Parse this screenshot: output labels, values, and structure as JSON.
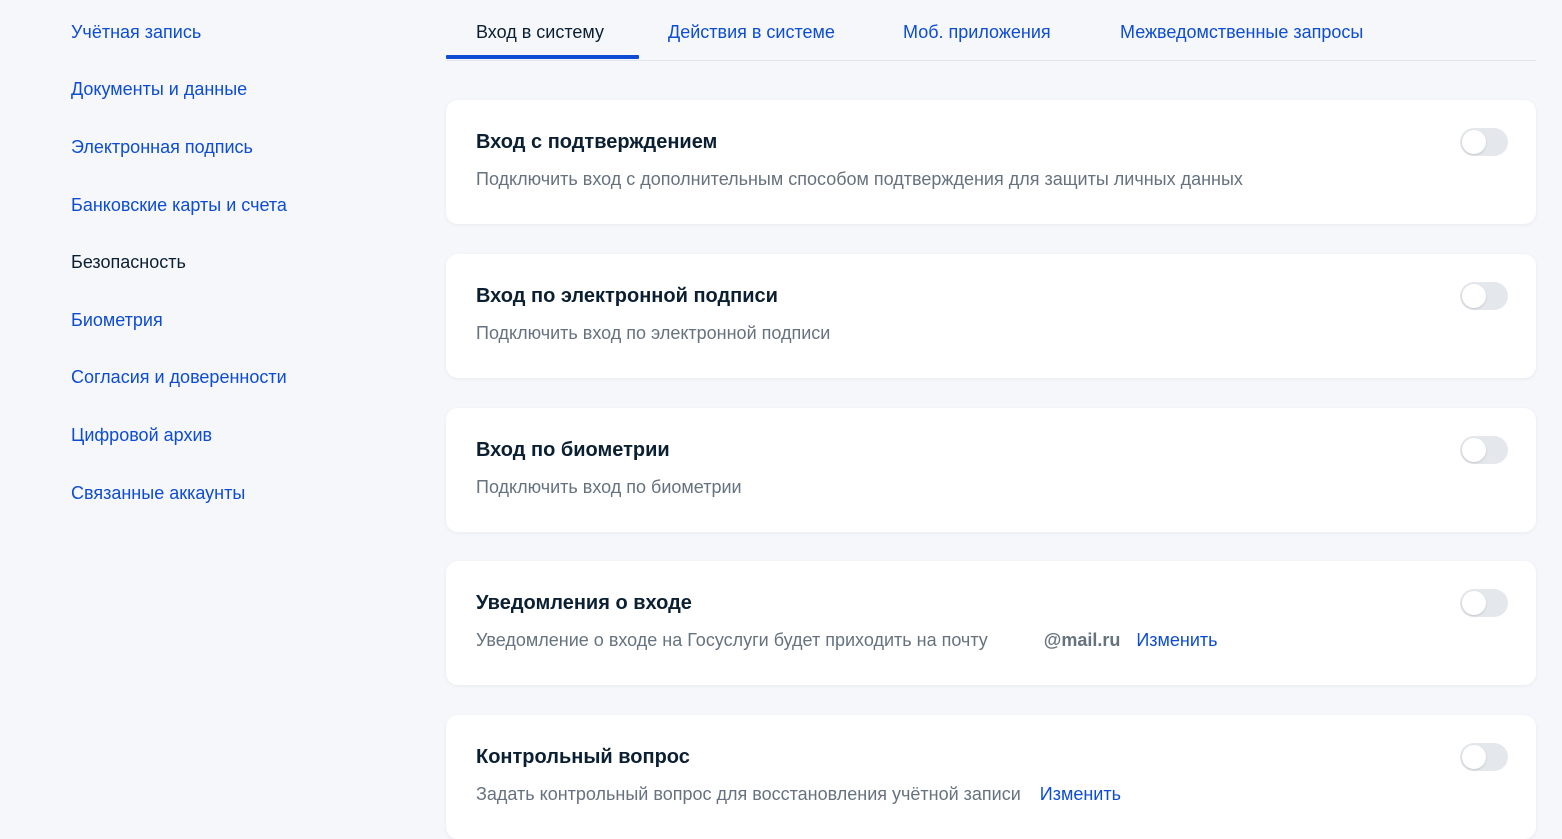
{
  "sidebar": {
    "items": [
      {
        "label": "Учётная запись"
      },
      {
        "label": "Документы и данные"
      },
      {
        "label": "Электронная подпись"
      },
      {
        "label": "Банковские карты и счета"
      },
      {
        "label": "Безопасность",
        "active": true
      },
      {
        "label": "Биометрия"
      },
      {
        "label": "Согласия и доверенности"
      },
      {
        "label": "Цифровой архив"
      },
      {
        "label": "Связанные аккаунты"
      }
    ]
  },
  "tabs": [
    {
      "label": "Вход в систему",
      "active": true
    },
    {
      "label": "Действия в системе"
    },
    {
      "label": "Моб. приложения"
    },
    {
      "label": "Межведомственные запросы"
    }
  ],
  "cards": [
    {
      "title": "Вход с подтверждением",
      "description": "Подключить вход с дополнительным способом подтверждения для защиты личных данных",
      "enabled": false
    },
    {
      "title": "Вход по электронной подписи",
      "description": "Подключить вход по электронной подписи",
      "enabled": false
    },
    {
      "title": "Вход по биометрии",
      "description": "Подключить вход по биометрии",
      "enabled": false
    },
    {
      "title": "Уведомления о входе",
      "description": "Уведомление о входе на Госуслуги будет приходить на почту",
      "email": "@mail.ru",
      "link": "Изменить",
      "enabled": false
    },
    {
      "title": "Контрольный вопрос",
      "description": "Задать контрольный вопрос для восстановления учётной записи",
      "link": "Изменить",
      "enabled": false
    }
  ],
  "colors": {
    "accent": "#0d4cd3",
    "text": "#0b1f33",
    "muted": "#66727f",
    "background": "#f5f7fb",
    "toggle_off": "#e4e7ec"
  }
}
